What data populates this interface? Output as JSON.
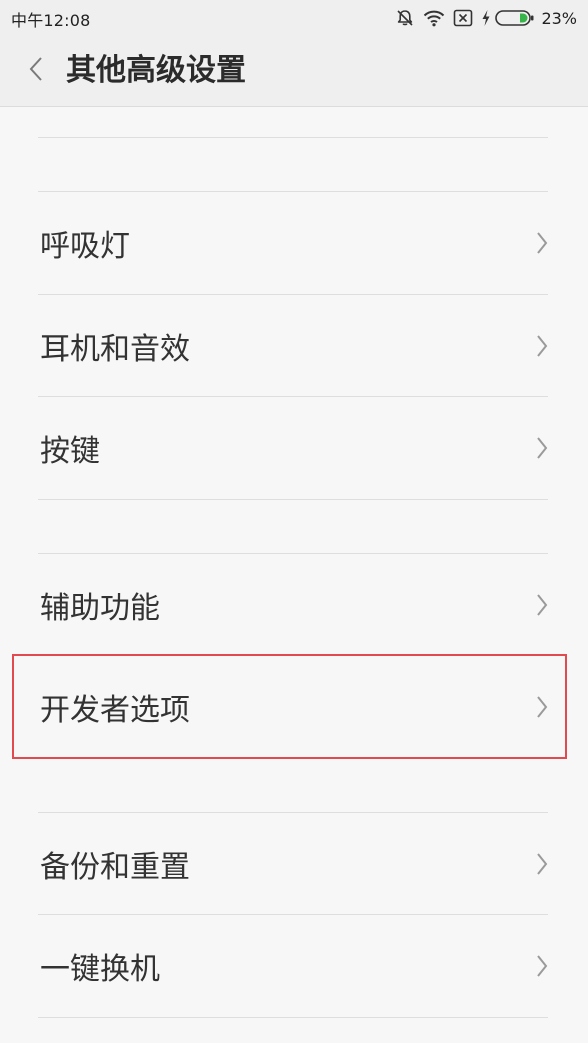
{
  "status_bar": {
    "time": "中午12:08",
    "battery_percent": "23%",
    "icons": [
      "bell-off-icon",
      "wifi-icon",
      "no-sim-icon",
      "charging-icon",
      "battery-icon"
    ],
    "battery_accent_color": "#38b54a"
  },
  "header": {
    "title": "其他高级设置",
    "back_icon": "chevron-left-icon"
  },
  "settings": {
    "items": [
      {
        "label": "呼吸灯"
      },
      {
        "label": "耳机和音效"
      },
      {
        "label": "按键"
      },
      {
        "label": "辅助功能"
      },
      {
        "label": "开发者选项"
      },
      {
        "label": "备份和重置"
      },
      {
        "label": "一键换机"
      }
    ],
    "chevron_icon": "chevron-right-icon",
    "highlighted_item": "开发者选项",
    "highlight_color": "#e34a4f"
  }
}
